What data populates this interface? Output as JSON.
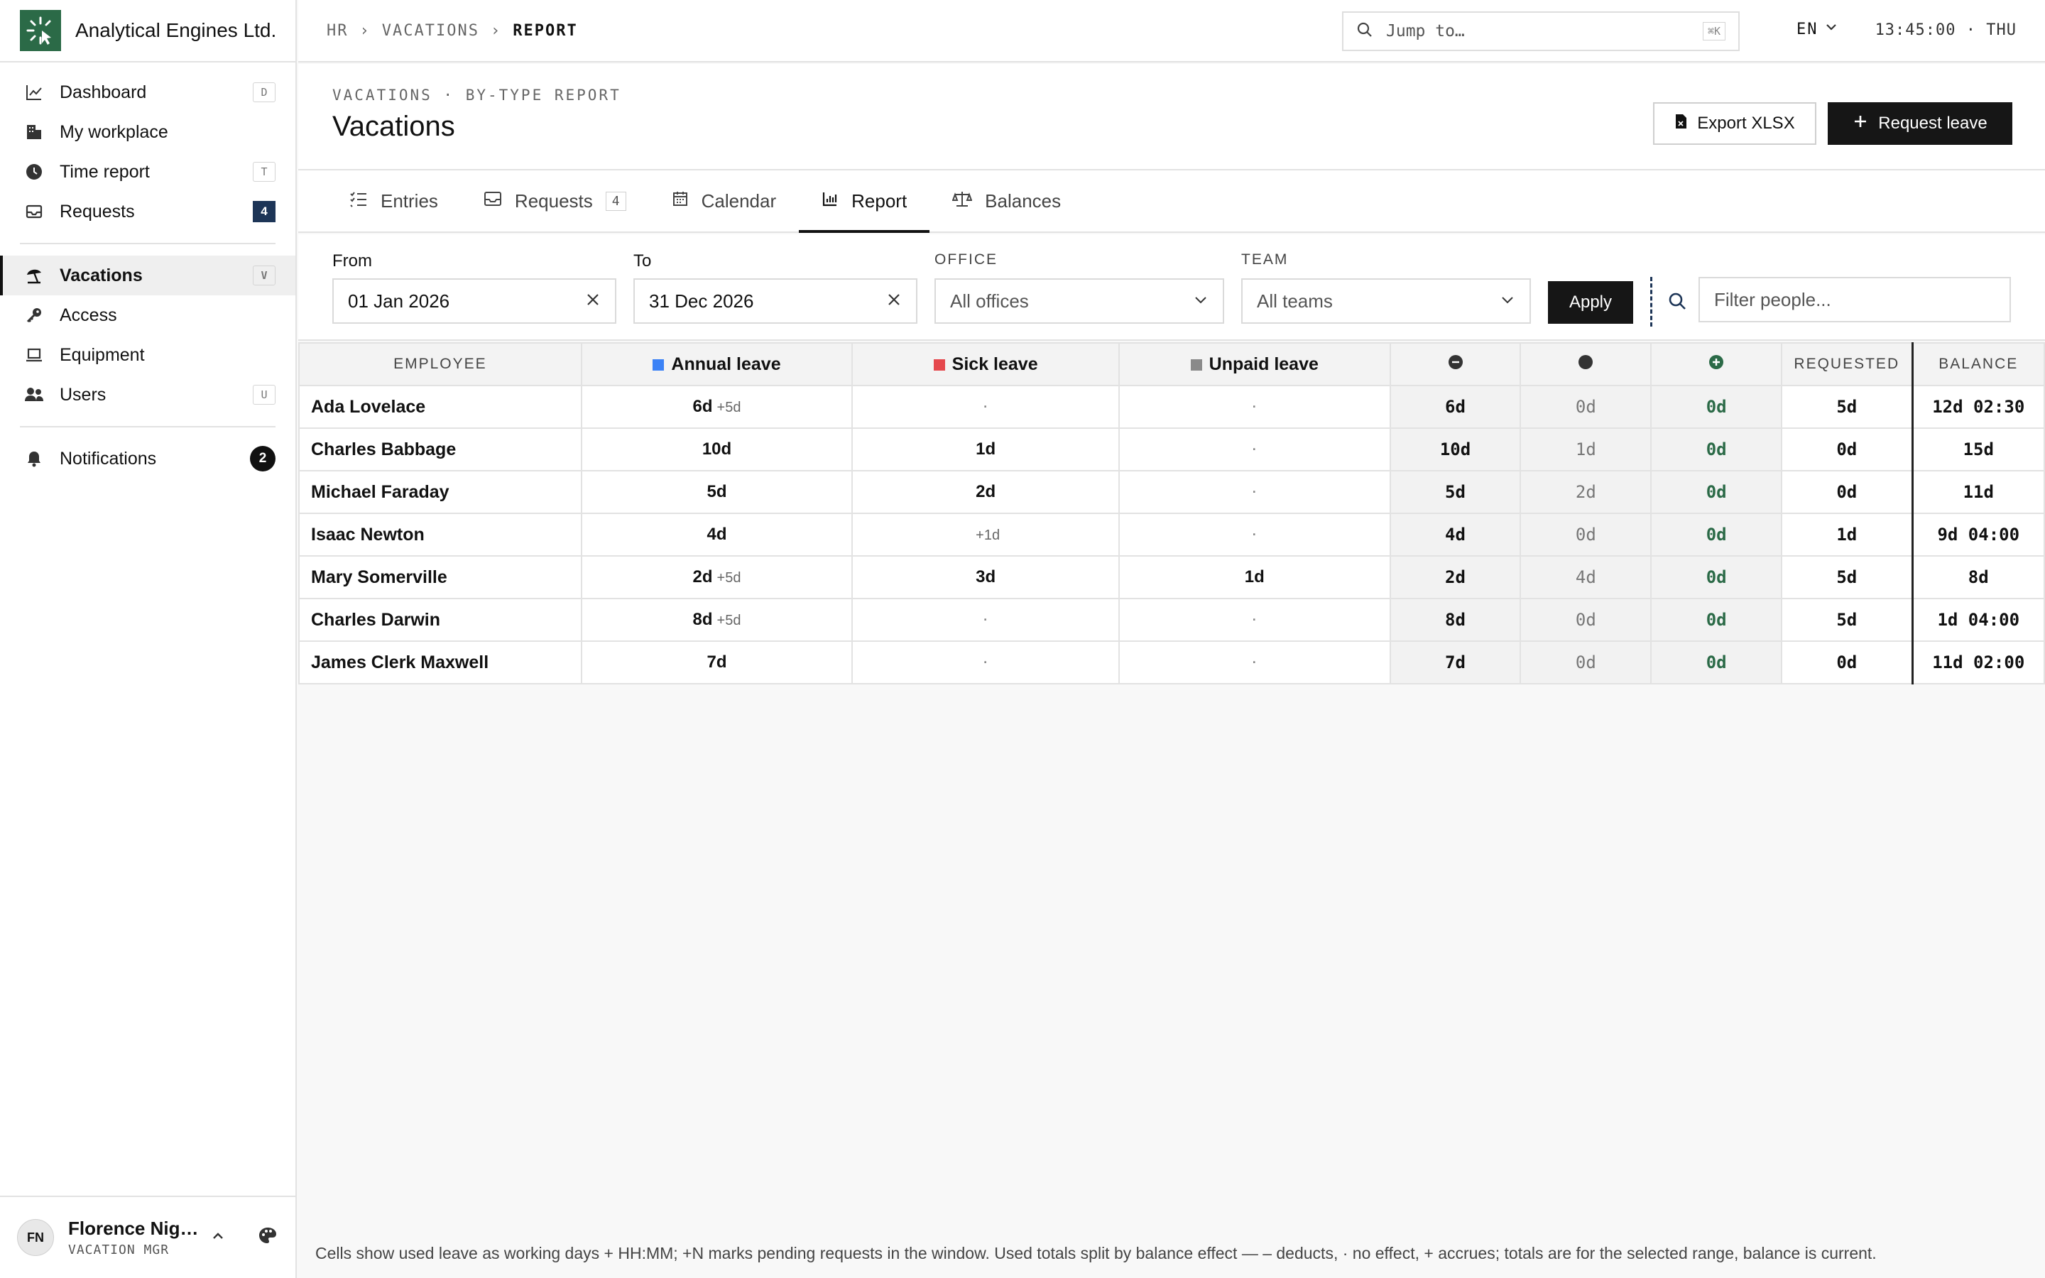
{
  "app": {
    "brand": "Analytical Engines Ltd.",
    "breadcrumb": [
      "HR",
      "VACATIONS",
      "REPORT"
    ],
    "search_placeholder": "Jump to…",
    "search_shortcut": "⌘K",
    "language": "EN",
    "clock": "13:45:00 · THU"
  },
  "sidebar": {
    "items": [
      {
        "label": "Dashboard",
        "icon": "chart-line-icon",
        "key": "D"
      },
      {
        "label": "My workplace",
        "icon": "building-icon",
        "key": ""
      },
      {
        "label": "Time report",
        "icon": "clock-icon",
        "key": "T"
      },
      {
        "label": "Requests",
        "icon": "inbox-icon",
        "badge": "4"
      },
      {
        "label": "Vacations",
        "icon": "beach-umbrella-icon",
        "key": "V",
        "active": true
      },
      {
        "label": "Access",
        "icon": "key-icon",
        "key": ""
      },
      {
        "label": "Equipment",
        "icon": "laptop-icon",
        "key": ""
      },
      {
        "label": "Users",
        "icon": "users-icon",
        "key": "U"
      },
      {
        "label": "Notifications",
        "icon": "bell-icon",
        "badge": "2"
      }
    ],
    "user": {
      "initials": "FN",
      "name": "Florence Nig…",
      "role": "VACATION MGR"
    }
  },
  "page": {
    "eyebrow": "VACATIONS · BY-TYPE REPORT",
    "title": "Vacations",
    "export_label": "Export XLSX",
    "request_label": "Request leave"
  },
  "tabs": [
    {
      "label": "Entries",
      "icon": "list-check-icon"
    },
    {
      "label": "Requests",
      "icon": "inbox-icon",
      "count": "4"
    },
    {
      "label": "Calendar",
      "icon": "calendar-icon"
    },
    {
      "label": "Report",
      "icon": "bar-chart-icon",
      "active": true
    },
    {
      "label": "Balances",
      "icon": "scale-icon"
    }
  ],
  "filters": {
    "from_label": "From",
    "from_value": "01 Jan 2026",
    "to_label": "To",
    "to_value": "31 Dec 2026",
    "office_label": "OFFICE",
    "office_value": "All offices",
    "team_label": "TEAM",
    "team_value": "All teams",
    "apply_label": "Apply",
    "people_placeholder": "Filter people..."
  },
  "table": {
    "headers": {
      "employee": "EMPLOYEE",
      "annual": "Annual leave",
      "sick": "Sick leave",
      "unpaid": "Unpaid leave",
      "requested": "REQUESTED",
      "balance": "BALANCE"
    },
    "colors": {
      "annual": "#3b82f6",
      "sick": "#e5484d",
      "unpaid": "#8a8a8a",
      "accent": "#2b6a47"
    },
    "rows": [
      {
        "name": "Ada Lovelace",
        "annual": "6d",
        "annual_pending": "+5d",
        "sick": "·",
        "sick_pending": "",
        "unpaid": "·",
        "deducts": "6d",
        "neutral": "0d",
        "accrues": "0d",
        "requested": "5d",
        "balance": "12d 02:30"
      },
      {
        "name": "Charles Babbage",
        "annual": "10d",
        "annual_pending": "",
        "sick": "1d",
        "sick_pending": "",
        "unpaid": "·",
        "deducts": "10d",
        "neutral": "1d",
        "accrues": "0d",
        "requested": "0d",
        "balance": "15d"
      },
      {
        "name": "Michael Faraday",
        "annual": "5d",
        "annual_pending": "",
        "sick": "2d",
        "sick_pending": "",
        "unpaid": "·",
        "deducts": "5d",
        "neutral": "2d",
        "accrues": "0d",
        "requested": "0d",
        "balance": "11d"
      },
      {
        "name": "Isaac Newton",
        "annual": "4d",
        "annual_pending": "",
        "sick": "",
        "sick_pending": "+1d",
        "unpaid": "·",
        "deducts": "4d",
        "neutral": "0d",
        "accrues": "0d",
        "requested": "1d",
        "balance": "9d 04:00"
      },
      {
        "name": "Mary Somerville",
        "annual": "2d",
        "annual_pending": "+5d",
        "sick": "3d",
        "sick_pending": "",
        "unpaid": "1d",
        "deducts": "2d",
        "neutral": "4d",
        "accrues": "0d",
        "requested": "5d",
        "balance": "8d"
      },
      {
        "name": "Charles Darwin",
        "annual": "8d",
        "annual_pending": "+5d",
        "sick": "·",
        "sick_pending": "",
        "unpaid": "·",
        "deducts": "8d",
        "neutral": "0d",
        "accrues": "0d",
        "requested": "5d",
        "balance": "1d 04:00"
      },
      {
        "name": "James Clerk Maxwell",
        "annual": "7d",
        "annual_pending": "",
        "sick": "·",
        "sick_pending": "",
        "unpaid": "·",
        "deducts": "7d",
        "neutral": "0d",
        "accrues": "0d",
        "requested": "0d",
        "balance": "11d 02:00"
      }
    ]
  },
  "footnote": "Cells show used leave as working days + HH:MM; +N marks pending requests in the window. Used totals split by balance effect — – deducts, · no effect, + accrues; totals are for the selected range, balance is current."
}
